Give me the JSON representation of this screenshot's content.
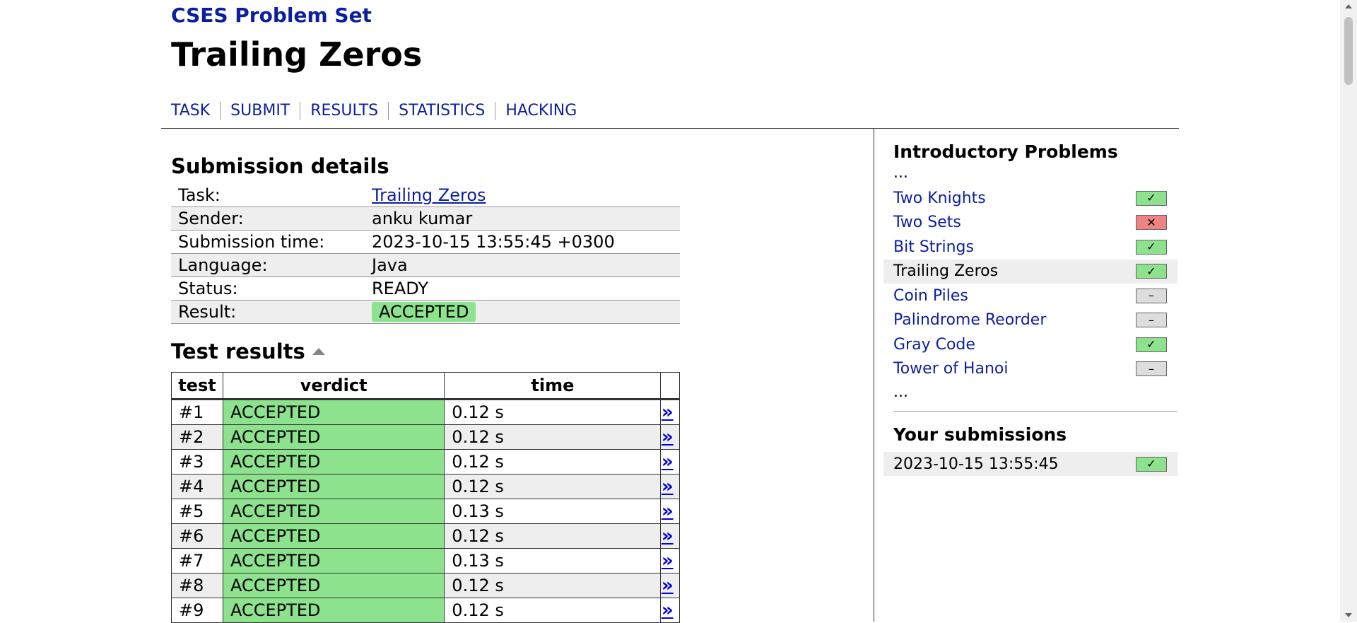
{
  "header": {
    "site_title": "CSES Problem Set",
    "task_title": "Trailing Zeros",
    "tabs": [
      {
        "label": "TASK"
      },
      {
        "label": "SUBMIT"
      },
      {
        "label": "RESULTS"
      },
      {
        "label": "STATISTICS"
      },
      {
        "label": "HACKING"
      }
    ]
  },
  "submission": {
    "heading": "Submission details",
    "rows": {
      "task": {
        "label": "Task:",
        "value": "Trailing Zeros"
      },
      "sender": {
        "label": "Sender:",
        "value": "anku kumar"
      },
      "time": {
        "label": "Submission time:",
        "value": "2023-10-15 13:55:45 +0300"
      },
      "language": {
        "label": "Language:",
        "value": "Java"
      },
      "status": {
        "label": "Status:",
        "value": "READY"
      },
      "result": {
        "label": "Result:",
        "value": "ACCEPTED"
      }
    }
  },
  "tests": {
    "heading": "Test results",
    "columns": {
      "test": "test",
      "verdict": "verdict",
      "time": "time"
    },
    "link_glyph": "»",
    "rows": [
      {
        "test": "#1",
        "verdict": "ACCEPTED",
        "time": "0.12 s"
      },
      {
        "test": "#2",
        "verdict": "ACCEPTED",
        "time": "0.12 s"
      },
      {
        "test": "#3",
        "verdict": "ACCEPTED",
        "time": "0.12 s"
      },
      {
        "test": "#4",
        "verdict": "ACCEPTED",
        "time": "0.12 s"
      },
      {
        "test": "#5",
        "verdict": "ACCEPTED",
        "time": "0.13 s"
      },
      {
        "test": "#6",
        "verdict": "ACCEPTED",
        "time": "0.12 s"
      },
      {
        "test": "#7",
        "verdict": "ACCEPTED",
        "time": "0.13 s"
      },
      {
        "test": "#8",
        "verdict": "ACCEPTED",
        "time": "0.12 s"
      },
      {
        "test": "#9",
        "verdict": "ACCEPTED",
        "time": "0.12 s"
      }
    ]
  },
  "sidebar": {
    "section_title": "Introductory Problems",
    "ellipsis": "...",
    "problems": [
      {
        "name": "Two Knights",
        "status": "full",
        "mark": "✓"
      },
      {
        "name": "Two Sets",
        "status": "zero",
        "mark": "✕"
      },
      {
        "name": "Bit Strings",
        "status": "full",
        "mark": "✓"
      },
      {
        "name": "Trailing Zeros",
        "status": "full",
        "mark": "✓",
        "current": true
      },
      {
        "name": "Coin Piles",
        "status": "none",
        "mark": "–"
      },
      {
        "name": "Palindrome Reorder",
        "status": "none",
        "mark": "–"
      },
      {
        "name": "Gray Code",
        "status": "full",
        "mark": "✓"
      },
      {
        "name": "Tower of Hanoi",
        "status": "none",
        "mark": "–"
      }
    ],
    "submissions_title": "Your submissions",
    "submissions": [
      {
        "time": "2023-10-15 13:55:45",
        "status": "full",
        "mark": "✓"
      }
    ]
  },
  "colors": {
    "link": "#0c1f9e",
    "accepted": "#8de38d",
    "failed": "#ef8383",
    "unattempted": "#dddddd"
  }
}
